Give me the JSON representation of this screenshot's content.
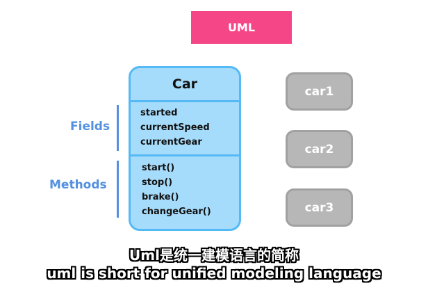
{
  "badge": {
    "label": "UML"
  },
  "class_box": {
    "name": "Car",
    "fields": [
      "started",
      "currentSpeed",
      "currentGear"
    ],
    "methods": [
      "start()",
      "stop()",
      "brake()",
      "changeGear()"
    ]
  },
  "labels": {
    "fields": "Fields",
    "methods": "Methods"
  },
  "instances": [
    "car1",
    "car2",
    "car3"
  ],
  "subtitles": {
    "zh": "Uml是统一建模语言的简称",
    "en": "uml is short for unified modeling language"
  },
  "colors": {
    "badge": "#f54788",
    "class_fill": "#a6dcfb",
    "class_border": "#55b9f5",
    "label": "#5390e0",
    "instance_fill": "#b7b7b7"
  }
}
